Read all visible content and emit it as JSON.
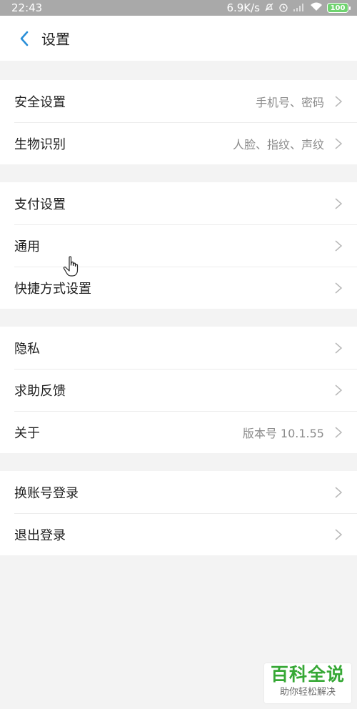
{
  "status_bar": {
    "time": "22:43",
    "net_speed": "6.9K/s",
    "battery": "100",
    "icons": [
      "mute-bell-icon",
      "alarm-icon",
      "signal-icon",
      "wifi-icon",
      "battery-icon"
    ]
  },
  "header": {
    "title": "设置",
    "back_icon": "chevron-left-icon"
  },
  "colors": {
    "accent": "#2a8fd8",
    "background": "#f3f3f3",
    "card": "#ffffff",
    "watermark_green": "#36a835"
  },
  "sections": [
    {
      "items": [
        {
          "label": "安全设置",
          "value": "手机号、密码"
        },
        {
          "label": "生物识别",
          "value": "人脸、指纹、声纹"
        }
      ]
    },
    {
      "items": [
        {
          "label": "支付设置",
          "value": ""
        },
        {
          "label": "通用",
          "value": ""
        },
        {
          "label": "快捷方式设置",
          "value": ""
        }
      ]
    },
    {
      "items": [
        {
          "label": "隐私",
          "value": ""
        },
        {
          "label": "求助反馈",
          "value": ""
        },
        {
          "label": "关于",
          "value": "版本号 10.1.55"
        }
      ]
    },
    {
      "items": [
        {
          "label": "换账号登录",
          "value": ""
        },
        {
          "label": "退出登录",
          "value": ""
        }
      ]
    }
  ],
  "watermark": {
    "title": "百科全说",
    "subtitle": "助你轻松解决"
  }
}
